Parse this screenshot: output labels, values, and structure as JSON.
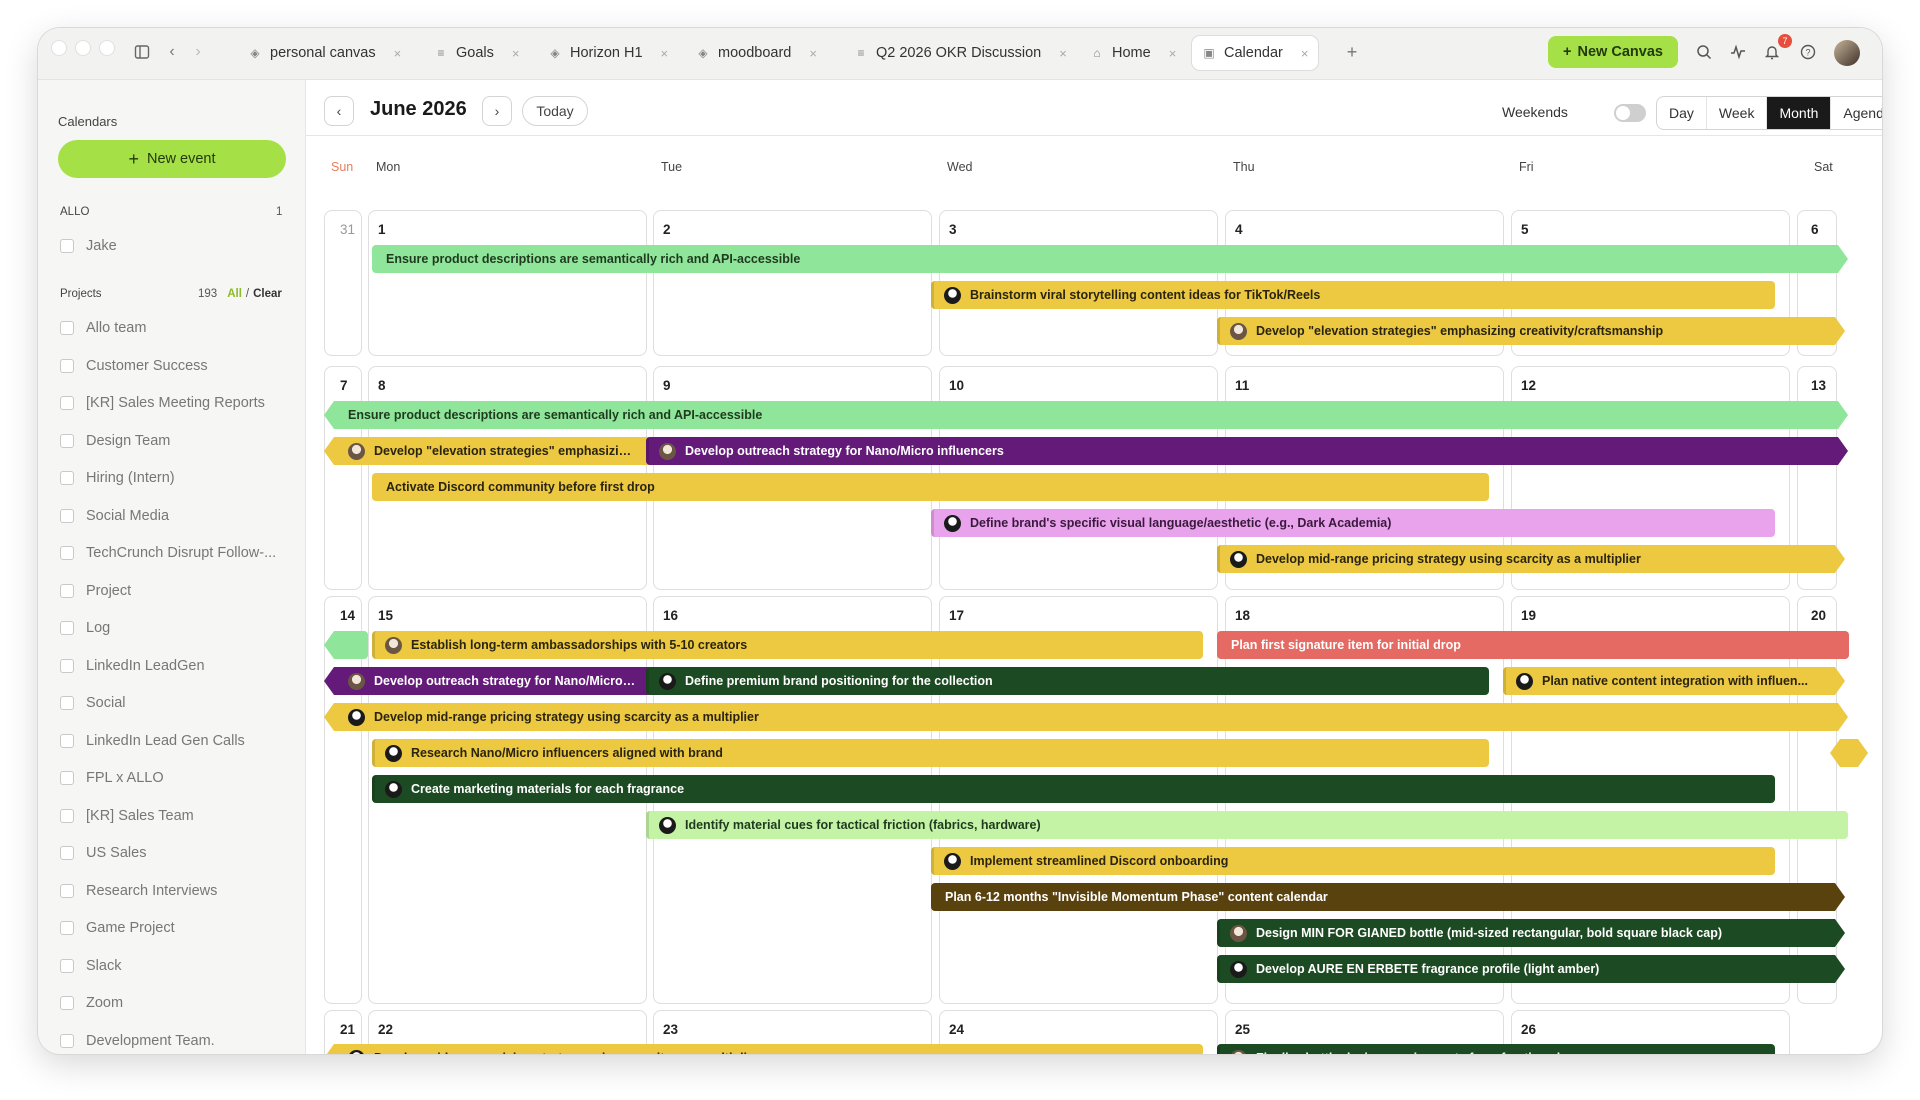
{
  "tabs": [
    {
      "label": "personal canvas"
    },
    {
      "label": "Goals"
    },
    {
      "label": "Horizon H1"
    },
    {
      "label": "moodboard"
    },
    {
      "label": "Q2 2026 OKR Discussion"
    },
    {
      "label": "Home"
    },
    {
      "label": "Calendar"
    }
  ],
  "toolbar": {
    "new_canvas": "New Canvas",
    "notifications": "7"
  },
  "sidebar": {
    "title": "Calendars",
    "new_event": "New event",
    "allo": {
      "label": "ALLO",
      "count": "1",
      "items": [
        "Jake"
      ]
    },
    "projects": {
      "label": "Projects",
      "count": "193",
      "all": "All",
      "sep": "/",
      "clear": "Clear",
      "items": [
        "Allo team",
        "Customer Success",
        "[KR] Sales Meeting Reports",
        "Design Team",
        "Hiring (Intern)",
        "Social Media",
        "TechCrunch Disrupt Follow-...",
        "Project",
        "Log",
        "LinkedIn LeadGen",
        "Social",
        "LinkedIn Lead Gen Calls",
        "FPL x ALLO",
        "[KR] Sales Team",
        "US Sales",
        "Research Interviews",
        "Game Project",
        "Slack",
        "Zoom",
        "Development Team."
      ]
    }
  },
  "calendar": {
    "month": "June 2026",
    "today": "Today",
    "weekends": "Weekends",
    "views": [
      "Day",
      "Week",
      "Month",
      "Agenda"
    ],
    "selected_view": "Month",
    "weekdays": [
      "Sun",
      "Mon",
      "Tue",
      "Wed",
      "Thu",
      "Fri",
      "Sat"
    ],
    "weeks": [
      [
        "31",
        "1",
        "2",
        "3",
        "4",
        "5",
        "6"
      ],
      [
        "7",
        "8",
        "9",
        "10",
        "11",
        "12",
        "13"
      ],
      [
        "14",
        "15",
        "16",
        "17",
        "18",
        "19",
        "20"
      ],
      [
        "21",
        "22",
        "23",
        "24",
        "25",
        "26",
        ""
      ]
    ],
    "events": [
      {
        "title": "Ensure product descriptions are semantically rich and API-accessible",
        "color": "#8fe69a",
        "text": "#1f3a1f"
      },
      {
        "title": "Brainstorm viral storytelling content ideas for TikTok/Reels",
        "color": "#ecc940",
        "text": "#2a2410"
      },
      {
        "title": "Develop \"elevation strategies\" emphasizing creativity/craftsmanship",
        "color": "#ecc940",
        "text": "#2a2410"
      },
      {
        "title": "Ensure product descriptions are semantically rich and API-accessible",
        "color": "#8fe69a",
        "text": "#1f3a1f"
      },
      {
        "title": "Develop \"elevation strategies\" emphasizing c...",
        "color": "#ecc940",
        "text": "#2a2410"
      },
      {
        "title": "Develop outreach strategy for Nano/Micro influencers",
        "color": "#641a78",
        "text": "#ffffff"
      },
      {
        "title": "Activate Discord community before first drop",
        "color": "#ecc940",
        "text": "#2a2410"
      },
      {
        "title": "Define brand's specific visual language/aesthetic (e.g., Dark Academia)",
        "color": "#e9a2ec",
        "text": "#3a1a3c"
      },
      {
        "title": "Develop mid-range pricing strategy using scarcity as a multiplier",
        "color": "#ecc940",
        "text": "#2a2410"
      },
      {
        "title": "Establish long-term ambassadorships with 5-10 creators",
        "color": "#ecc940",
        "text": "#2a2410"
      },
      {
        "title": "Plan first signature item for initial drop",
        "color": "#e56a63",
        "text": "#ffffff"
      },
      {
        "title": "Develop outreach strategy for Nano/Micro i...",
        "color": "#641a78",
        "text": "#ffffff"
      },
      {
        "title": "Define premium brand positioning for the collection",
        "color": "#1c4a22",
        "text": "#ffffff"
      },
      {
        "title": "Plan native content integration with influen...",
        "color": "#ecc940",
        "text": "#2a2410"
      },
      {
        "title": "Develop mid-range pricing strategy using scarcity as a multiplier",
        "color": "#ecc940",
        "text": "#2a2410"
      },
      {
        "title": "Research Nano/Micro influencers aligned with brand",
        "color": "#ecc940",
        "text": "#2a2410"
      },
      {
        "title": "Create marketing materials for each fragrance",
        "color": "#1c4a22",
        "text": "#ffffff"
      },
      {
        "title": "Identify material cues for tactical friction (fabrics, hardware)",
        "color": "#c4f3a6",
        "text": "#1f3a1f"
      },
      {
        "title": "Implement streamlined Discord onboarding",
        "color": "#ecc940",
        "text": "#2a2410"
      },
      {
        "title": "Plan 6-12 months \"Invisible Momentum Phase\" content calendar",
        "color": "#5a420f",
        "text": "#ffffff"
      },
      {
        "title": "Design MIN FOR GIANED bottle (mid-sized rectangular, bold square black cap)",
        "color": "#1c4a22",
        "text": "#ffffff"
      },
      {
        "title": "Develop AURE EN ERBETE fragrance profile (light amber)",
        "color": "#1c4a22",
        "text": "#ffffff"
      },
      {
        "title": "Develop mid-range pricing strategy using scarcity as a multiplier",
        "color": "#ecc940",
        "text": "#2a2410"
      },
      {
        "title": "Finalize bottle design requirements for refractive glass",
        "color": "#1c4a22",
        "text": "#ffffff"
      },
      {
        "title": "",
        "color": "#8fe69a",
        "text": "#1f3a1f"
      },
      {
        "title": "",
        "color": "#ecc940",
        "text": "#2a2410"
      }
    ]
  }
}
